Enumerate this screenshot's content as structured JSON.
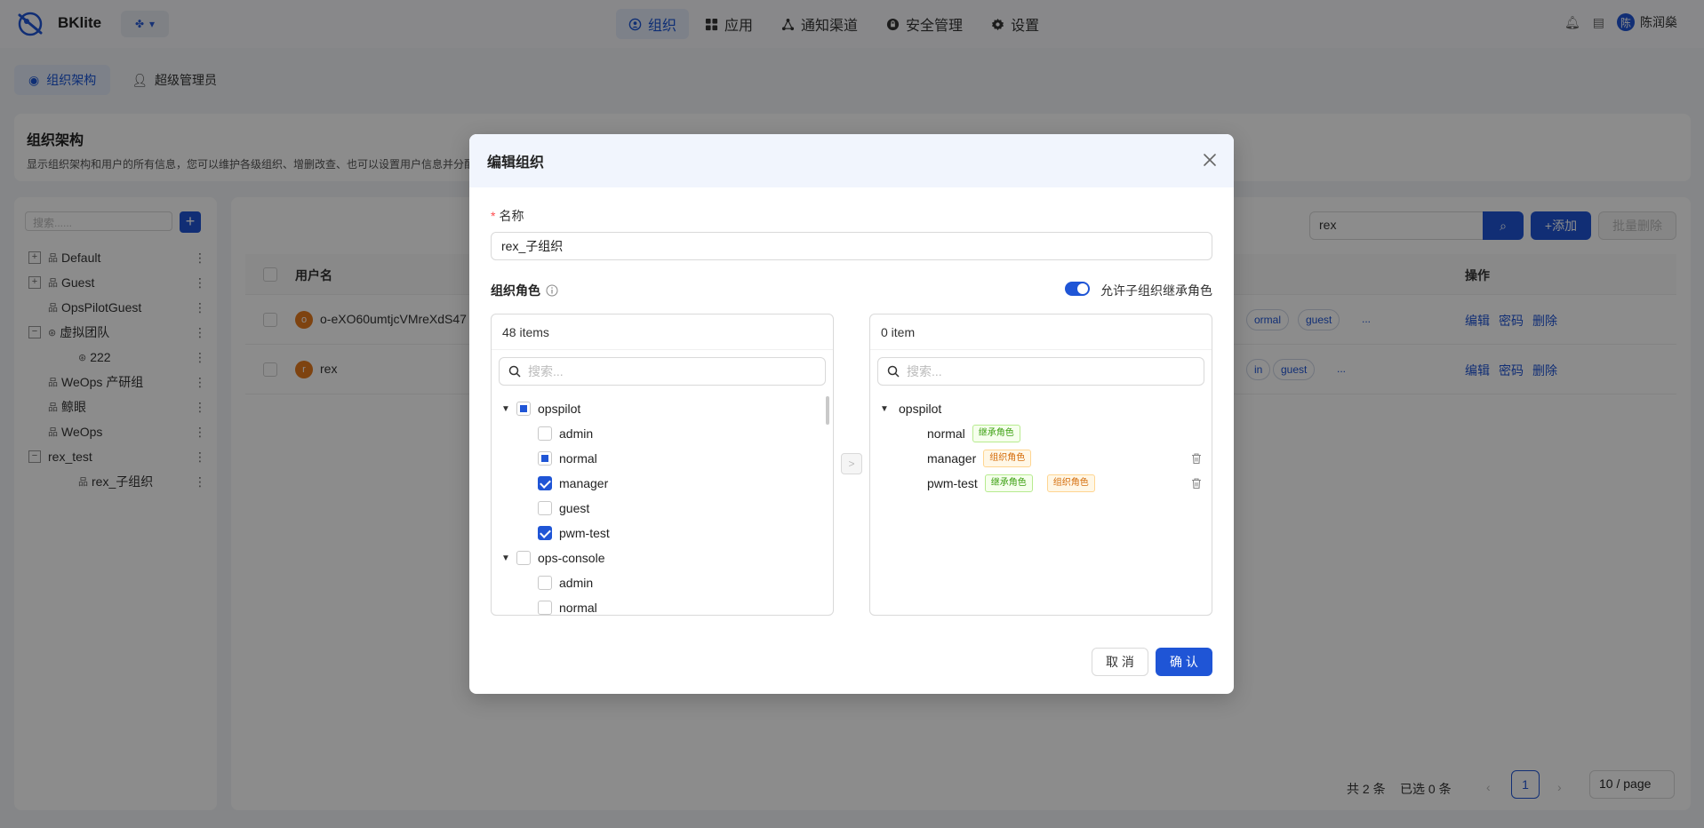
{
  "app": {
    "brand": "BKlite",
    "brand_color": "#1f55d6"
  },
  "nav": {
    "items": [
      {
        "label": "组织",
        "icon": "org-icon",
        "active": true
      },
      {
        "label": "应用",
        "icon": "apps-icon"
      },
      {
        "label": "通知渠道",
        "icon": "channel-icon"
      },
      {
        "label": "安全管理",
        "icon": "security-icon"
      },
      {
        "label": "设置",
        "icon": "gear-icon"
      }
    ],
    "user": {
      "avatar": "陈",
      "name": "陈润燊"
    }
  },
  "subtabs": [
    {
      "label": "组织架构",
      "active": true
    },
    {
      "label": "超级管理员"
    }
  ],
  "header": {
    "title": "组织架构",
    "desc": "显示组织架构和用户的所有信息，您可以维护各级组织、增删改查、也可以设置用户信息并分配"
  },
  "tree": {
    "search_placeholder": "搜索......",
    "items": [
      {
        "label": "Default",
        "expander": "+",
        "icon": "org-icon"
      },
      {
        "label": "Guest",
        "expander": "+",
        "icon": "org-icon"
      },
      {
        "label": "OpsPilotGuest",
        "icon": "org-icon"
      },
      {
        "label": "虚拟团队",
        "expander": "−",
        "icon": "team-icon"
      },
      {
        "label": "222",
        "icon": "team-icon",
        "child": true
      },
      {
        "label": "WeOps 产研组",
        "icon": "org-icon"
      },
      {
        "label": "鲸眼",
        "icon": "org-icon"
      },
      {
        "label": "WeOps",
        "icon": "org-icon"
      },
      {
        "label": "rex_test",
        "expander": "−"
      },
      {
        "label": "rex_子组织",
        "icon": "org-icon",
        "child": true
      }
    ]
  },
  "table": {
    "search_value": "rex",
    "add_label": "+添加",
    "batch_delete_label": "批量删除",
    "col_user": "用户名",
    "col_ops": "操作",
    "rows": [
      {
        "avatar": "o",
        "name": "o-eXO60umtjcVMreXdS47",
        "chip1": "ormal",
        "chip2": "guest",
        "more": "..."
      },
      {
        "avatar": "r",
        "name": "rex",
        "chip1": "in",
        "chip2": "guest",
        "more": "..."
      }
    ],
    "op_edit": "编辑",
    "op_password": "密码",
    "op_delete": "删除",
    "total": "共 2 条",
    "selected": "已选 0 条",
    "page": "1",
    "page_size": "10 / page"
  },
  "modal": {
    "title": "编辑组织",
    "name_label": "名称",
    "name_value": "rex_子组织",
    "role_label": "组织角色",
    "inherit_toggle_label": "允许子组织继承角色",
    "inherit_enabled": true,
    "left": {
      "count": "48 items",
      "search_placeholder": "搜索...",
      "groups": [
        {
          "name": "opspilot",
          "state": "partial",
          "children": [
            {
              "name": "admin",
              "state": "unchecked"
            },
            {
              "name": "normal",
              "state": "partial"
            },
            {
              "name": "manager",
              "state": "checked"
            },
            {
              "name": "guest",
              "state": "unchecked"
            },
            {
              "name": "pwm-test",
              "state": "checked"
            }
          ]
        },
        {
          "name": "ops-console",
          "state": "unchecked",
          "children": [
            {
              "name": "admin",
              "state": "unchecked"
            },
            {
              "name": "normal",
              "state": "unchecked"
            }
          ]
        }
      ]
    },
    "right": {
      "count": "0 item",
      "search_placeholder": "搜索...",
      "group": "opspilot",
      "tag_inherit": "继承角色",
      "tag_org": "组织角色",
      "items": [
        {
          "name": "normal",
          "tags": [
            "inherit"
          ]
        },
        {
          "name": "manager",
          "tags": [
            "org"
          ]
        },
        {
          "name": "pwm-test",
          "tags": [
            "inherit",
            "org"
          ]
        }
      ]
    },
    "cancel_label": "取 消",
    "ok_label": "确 认"
  }
}
